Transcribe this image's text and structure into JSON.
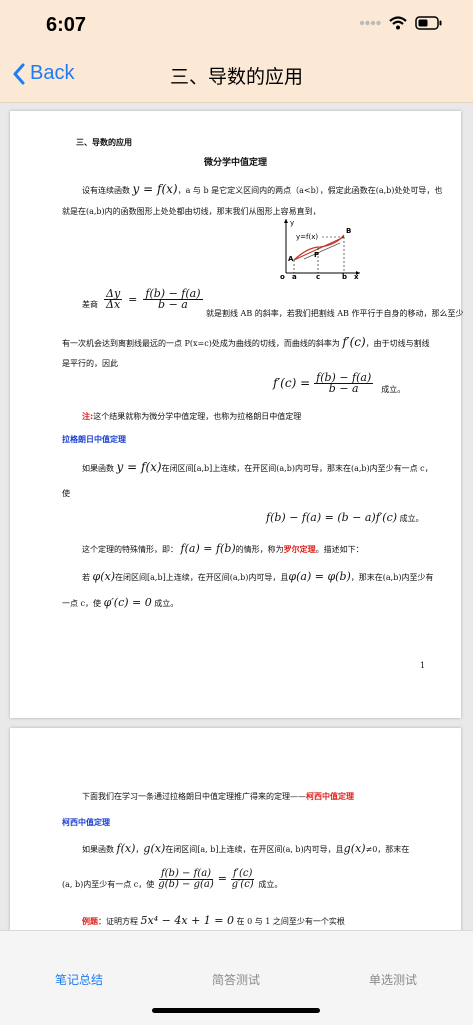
{
  "status_bar": {
    "time": "6:07"
  },
  "nav": {
    "back_label": "Back",
    "title": "三、导数的应用"
  },
  "doc": {
    "page1": {
      "section_heading": "三、导数的应用",
      "theorem_title": "微分学中值定理",
      "para1_a": "设有连续函数",
      "para1_math": "y = f(x)",
      "para1_b": "，a 与 b 是它定义区间内的两点（a<b），假定此函数在(a,b)处处可导，也",
      "para1_c": "就是在(a,b)内的函数图形上处处都由切线，那末我们从图形上容易直到，",
      "figure": {
        "fx_label": "y=f(x)",
        "A": "A",
        "B": "B",
        "P": "P",
        "o": "o",
        "a": "a",
        "c": "c",
        "b": "b",
        "x": "x",
        "y": "y"
      },
      "para2_num": "Δy",
      "para2_den": "Δx",
      "para2_rhs_num": "f(b) − f(a)",
      "para2_rhs_den": "b − a",
      "para2_a": "差商",
      "para2_b": "就是割线 AB 的斜率，若我们把割线 AB 作平行于自身的移动，那么至少",
      "para2_c": "有一次机会达到离割线最远的一点 P(x=c)处成为曲线的切线，而曲线的斜率为",
      "para2_math": "f′(c)",
      "para2_d": "，由于切线与割线",
      "para2_e": "是平行的，因此",
      "eq1_lhs": "f′(c) =",
      "eq1_num": "f(b) − f(a)",
      "eq1_den": "b − a",
      "eq1_suffix": "成立。",
      "note_label": "注:",
      "note_text": "这个结果就称为微分学中值定理，也称为拉格朗日中值定理",
      "lagrange_title": "拉格朗日中值定理",
      "para3_a": "如果函数",
      "para3_math": "y = f(x)",
      "para3_b": "在闭区间[a,b]上连续，在开区间(a,b)内可导，那末在(a,b)内至少有一点 c，",
      "para3_c": "使",
      "eq2": "f(b) − f(a) = (b − a)f′(c)",
      "eq2_suffix": "成立。",
      "para4_a": "这个定理的特殊情形，即：",
      "para4_math": "f(a) = f(b)",
      "para4_b": "的情形，称为",
      "para4_rolle": "罗尔定理",
      "para4_c": "。描述如下：",
      "para5_a": "若",
      "para5_phi": "φ(x)",
      "para5_b": "在闭区间[a,b]上连续，在开区间(a,b)内可导，且",
      "para5_eq": "φ(a) = φ(b)",
      "para5_c": "，那末在(a,b)内至少有",
      "para5_d": "一点 c，使",
      "para5_res": "φ′(c) = 0",
      "para5_e": "成立。",
      "page_number": "1"
    },
    "page2": {
      "intro_a": "下面我们在学习一条通过拉格朗日中值定理推广得来的定理——",
      "intro_cauchy": "柯西中值定理",
      "cauchy_title": "柯西中值定理",
      "para1_a": "如果函数",
      "para1_f": "f(x)",
      "para1_sep": "，",
      "para1_g": "g(x)",
      "para1_b": "在闭区间[a, b]上连续，在开区间(a, b)内可导，且",
      "para1_g2": "g(x)",
      "para1_c": "≠0，那末在",
      "para2_a": "(a, b)内至少有一点 c，使",
      "frac_l_num": "f(b) − f(a)",
      "frac_l_den": "g(b) − g(a)",
      "frac_eq": "=",
      "frac_r_num": "f′(c)",
      "frac_r_den": "g′(c)",
      "para2_b": "成立。",
      "example_label": "例题：",
      "example_a": "证明方程",
      "example_math": "5x⁴ − 4x + 1 = 0",
      "example_b": "在 0 与 1 之间至少有一个实根"
    }
  },
  "tabs": [
    {
      "label": "笔记总结",
      "active": true
    },
    {
      "label": "简答测试",
      "active": false
    },
    {
      "label": "单选测试",
      "active": false
    }
  ],
  "colors": {
    "accent": "#1e7cf5",
    "nav_bg": "#fbe9d6",
    "heading_blue": "#1a3fd1",
    "highlight_red": "#e0201c"
  }
}
